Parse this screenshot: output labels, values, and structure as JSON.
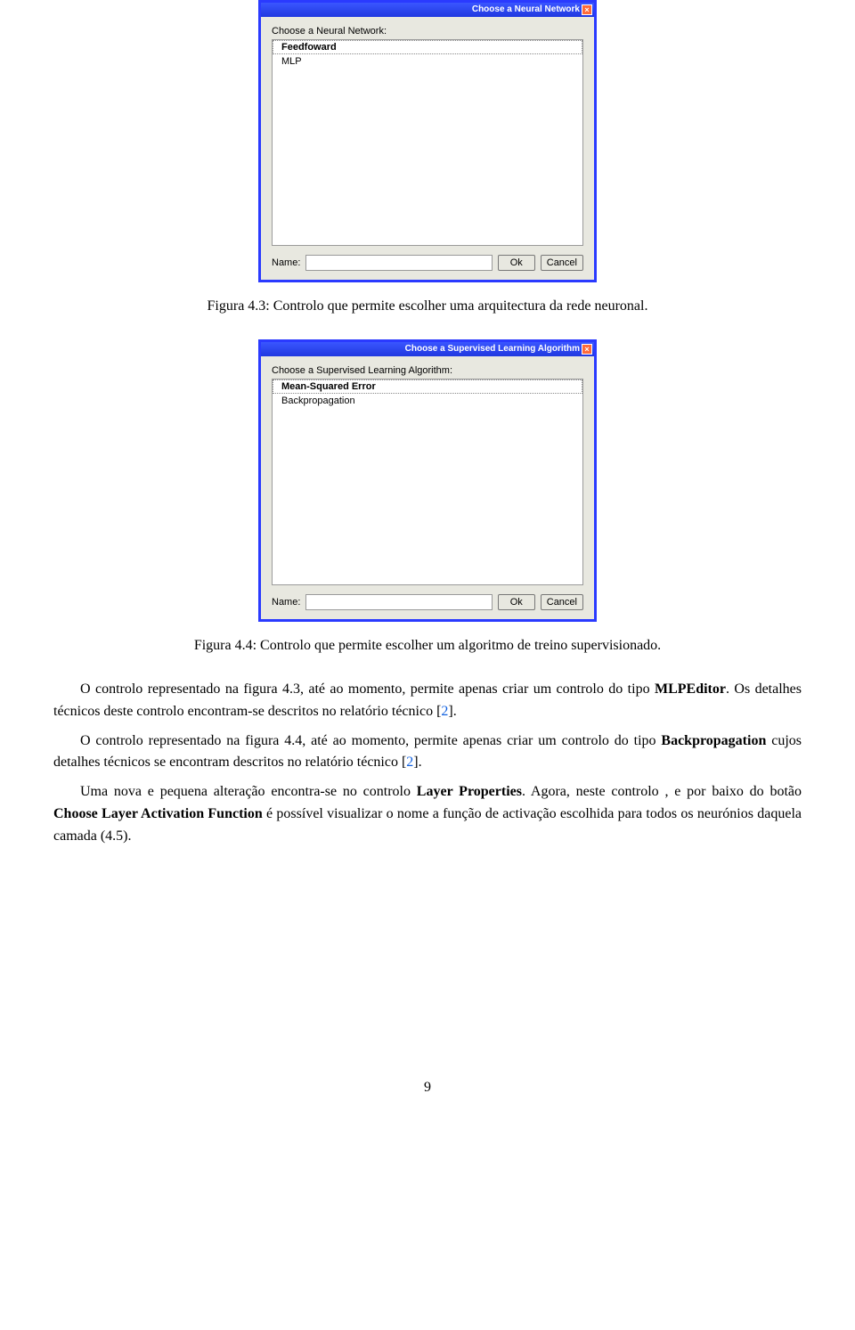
{
  "figure1": {
    "title": "Choose a Neural Network",
    "prompt": "Choose a Neural Network:",
    "items": [
      "Feedfoward",
      "MLP"
    ],
    "selected_index": 0,
    "name_label": "Name:",
    "name_value": "",
    "ok_label": "Ok",
    "cancel_label": "Cancel",
    "caption": "Figura 4.3: Controlo que permite escolher uma arquitectura da rede neuronal."
  },
  "figure2": {
    "title": "Choose a Supervised Learning Algorithm",
    "prompt": "Choose a Supervised Learning Algorithm:",
    "items": [
      "Mean-Squared Error",
      "Backpropagation"
    ],
    "selected_index": 0,
    "name_label": "Name:",
    "name_value": "",
    "ok_label": "Ok",
    "cancel_label": "Cancel",
    "caption": "Figura 4.4: Controlo que permite escolher um algoritmo de treino supervisionado."
  },
  "paragraphs": {
    "p1_a": "O controlo representado na figura 4.3, até ao momento, permite apenas criar um controlo do tipo ",
    "p1_bold": "MLPEditor",
    "p1_b": ". Os detalhes técnicos deste controlo encontram-se descritos no relatório técnico [",
    "p1_ref": "2",
    "p1_c": "].",
    "p2_a": "O controlo representado na figura 4.4, até ao momento, permite apenas criar um controlo do tipo ",
    "p2_bold": "Backpropagation",
    "p2_b": " cujos detalhes técnicos se encontram descritos no relatório técnico [",
    "p2_ref": "2",
    "p2_c": "].",
    "p3_a": "Uma nova e pequena alteração encontra-se no controlo ",
    "p3_bold1": "Layer Properties",
    "p3_b": ". Agora, neste controlo , e por baixo do botão ",
    "p3_bold2": "Choose Layer Activation Function",
    "p3_c": " é possível visualizar o nome a função de activação escolhida para todos os neurónios daquela camada (4.5)."
  },
  "page_number": "9"
}
